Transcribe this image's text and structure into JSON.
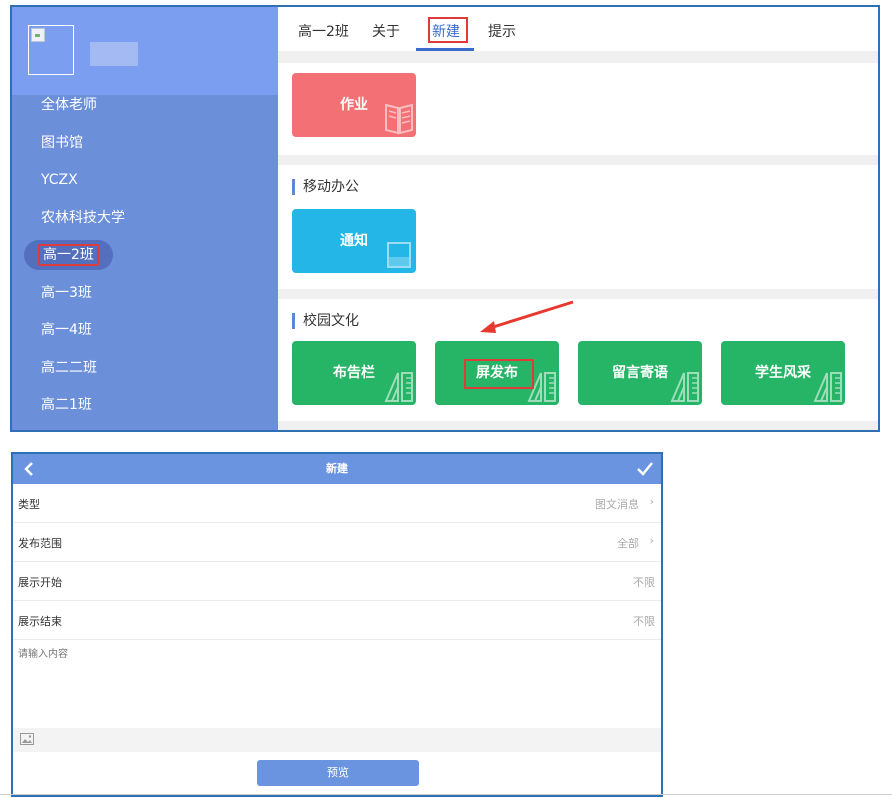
{
  "sidebar": {
    "items": [
      {
        "label": "全体老师"
      },
      {
        "label": "图书馆"
      },
      {
        "label": "YCZX"
      },
      {
        "label": "农林科技大学"
      },
      {
        "label": "高一2班"
      },
      {
        "label": "高一3班"
      },
      {
        "label": "高一4班"
      },
      {
        "label": "高二二班"
      },
      {
        "label": "高二1班"
      }
    ]
  },
  "tabs": [
    {
      "label": "高一2班"
    },
    {
      "label": "关于"
    },
    {
      "label": "新建"
    },
    {
      "label": "提示"
    }
  ],
  "sections": {
    "s1": {
      "tiles": [
        {
          "label": "作业"
        }
      ]
    },
    "s2": {
      "title": "移动办公",
      "tiles": [
        {
          "label": "通知"
        }
      ]
    },
    "s3": {
      "title": "校园文化",
      "tiles": [
        {
          "label": "布告栏"
        },
        {
          "label": "屏发布"
        },
        {
          "label": "留言寄语"
        },
        {
          "label": "学生风采"
        }
      ]
    }
  },
  "colors": {
    "sidebar": "#6b8fd9",
    "accent": "#3a6ccc",
    "highlight": "#e03b3b",
    "tile_red": "#f37075",
    "tile_blue": "#23b6e6",
    "tile_green": "#26b466"
  },
  "form": {
    "title": "新建",
    "rows": [
      {
        "label": "类型",
        "value": "图文消息",
        "arrow": "›"
      },
      {
        "label": "发布范围",
        "value": "全部",
        "arrow": "›"
      },
      {
        "label": "展示开始",
        "value": "不限"
      },
      {
        "label": "展示结束",
        "value": "不限"
      }
    ],
    "content_placeholder": "请输入内容",
    "preview_label": "预览"
  }
}
